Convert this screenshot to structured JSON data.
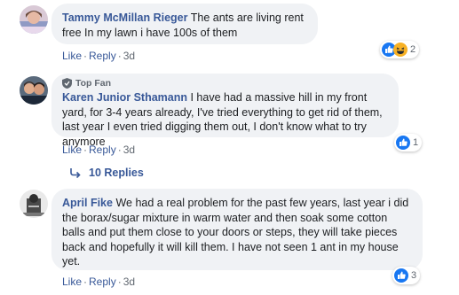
{
  "comments": [
    {
      "author": "Tammy McMillan Rieger",
      "text": " The ants are living rent free In my lawn i have 100s of them",
      "actions": {
        "like": "Like",
        "reply": "Reply",
        "time": "3d"
      },
      "reactions": {
        "count": "2",
        "icons": [
          "like-icon",
          "haha-icon"
        ]
      }
    },
    {
      "badge": "Top Fan",
      "author": "Karen Junior Sthamann",
      "text": " I have had a massive hill in my front yard, for 3-4 years already, I've tried everything to get rid of them, last year I even tried digging them out, I don't know what to try anymore",
      "actions": {
        "like": "Like",
        "reply": "Reply",
        "time": "3d"
      },
      "reactions": {
        "count": "1",
        "icons": [
          "like-icon"
        ]
      }
    },
    {
      "author": "April Fike",
      "text": " We had a real problem for the past few years, last year i did the borax/sugar mixture in warm water and then soak some cotton balls and put them close to your doors or steps, they will take pieces back and hopefully it will kill them. I have not seen 1 ant in my house yet.",
      "actions": {
        "like": "Like",
        "reply": "Reply",
        "time": "3d"
      },
      "reactions": {
        "count": "3",
        "icons": [
          "like-icon"
        ]
      }
    }
  ],
  "replies_link": "10 Replies",
  "colors": {
    "link": "#385898",
    "bubble": "#f0f2f5",
    "like": "#1877f2",
    "muted": "#606770"
  }
}
